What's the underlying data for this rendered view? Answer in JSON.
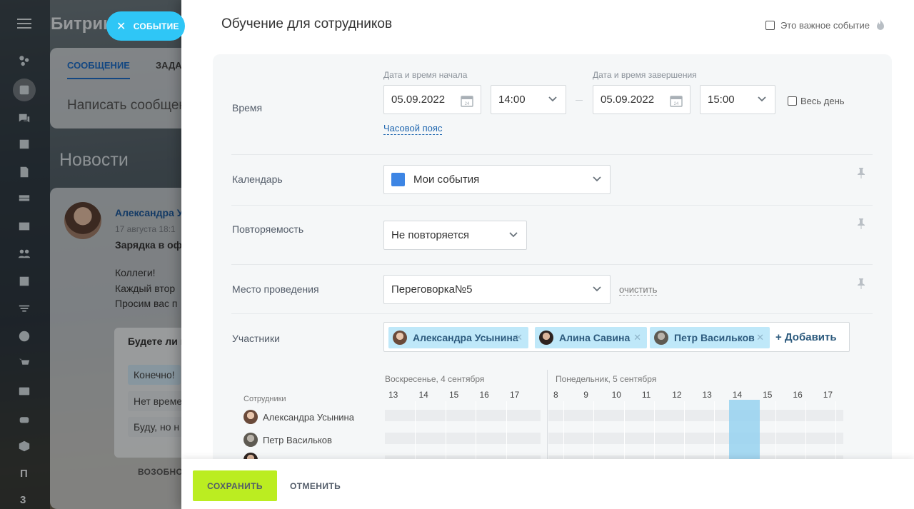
{
  "background": {
    "brand": "Битрик",
    "event_chip_label": "СОБЫТИЕ",
    "feed_tab_active": "СООБЩЕНИЕ",
    "feed_tab_2": "ЗАДАЧ",
    "compose_placeholder": "Написать сообщен",
    "news_heading": "Новости",
    "post": {
      "author": "Александра У",
      "date": "17 августа 18:1",
      "title": "Зарядка в оф",
      "lines": [
        "Коллеги!",
        "Каждый втор",
        "Просим вас п"
      ],
      "poll_question": "Будете ли в",
      "poll_options": [
        "Конечно!",
        "Нет време",
        "Буду, но н"
      ],
      "return_label": "ВОЗОБНО"
    },
    "rail_letters": [
      "П",
      "3"
    ]
  },
  "panel": {
    "title": "Обучение для сотрудников",
    "important_label": "Это важное событие",
    "time": {
      "label": "Время",
      "start_caption": "Дата и время начала",
      "end_caption": "Дата и время завершения",
      "start_date": "05.09.2022",
      "start_time": "14:00",
      "end_date": "05.09.2022",
      "end_time": "15:00",
      "all_day_label": "Весь день",
      "timezone_link": "Часовой пояс"
    },
    "calendar": {
      "label": "Календарь",
      "value": "Мои события",
      "color": "#3d85e4"
    },
    "repeat": {
      "label": "Повторяемость",
      "value": "Не повторяется"
    },
    "location": {
      "label": "Место проведения",
      "value": "Переговорка№5",
      "clear_link": "очистить"
    },
    "participants": {
      "label": "Участники",
      "members": [
        "Александра Усынина",
        "Алина Савина",
        "Петр Васильков"
      ],
      "add_label": "+ Добавить"
    },
    "planner": {
      "day1": "Воскресенье, 4 сентября",
      "day2": "Понедельник, 5 сентября",
      "day1_hours": [
        "13",
        "14",
        "15",
        "16",
        "17"
      ],
      "day2_hours": [
        "8",
        "9",
        "10",
        "11",
        "12",
        "13",
        "14",
        "15",
        "16",
        "17"
      ],
      "employees_caption": "Сотрудники",
      "employees": [
        "Александра Усынина",
        "Петр Васильков"
      ]
    },
    "footer": {
      "save": "СОХРАНИТЬ",
      "cancel": "ОТМЕНИТЬ"
    }
  }
}
